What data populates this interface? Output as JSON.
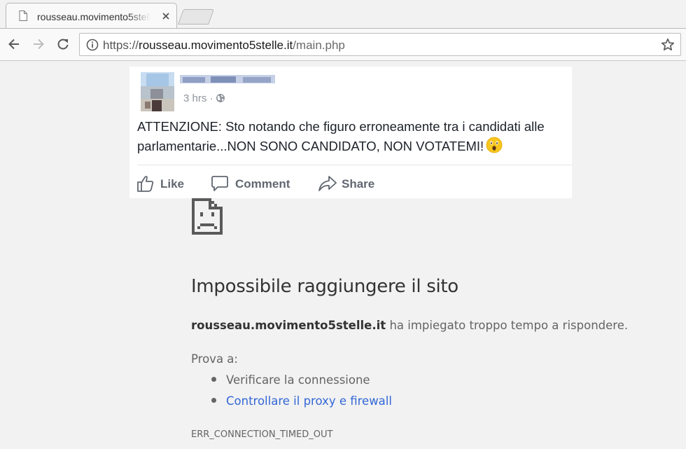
{
  "tab": {
    "title": "rousseau.movimento5stelle.it",
    "favicon": "page-icon",
    "close_icon": "close-icon"
  },
  "toolbar": {
    "back_icon": "back-arrow-icon",
    "forward_icon": "forward-arrow-icon",
    "reload_icon": "reload-icon",
    "info_icon": "info-icon",
    "bookmark_icon": "star-icon"
  },
  "address": {
    "scheme": "https://",
    "host": "rousseau.movimento5stelle.it",
    "path": "/main.php"
  },
  "post": {
    "time": "3 hrs ·",
    "audience_icon": "globe-icon",
    "line1": "ATTENZIONE: Sto notando che figuro erroneamente tra i candidati alle",
    "line2": "parlamentarie...NON SONO CANDIDATO, NON VOTATEMI!",
    "emoji": "astonished-face-emoji",
    "actions": {
      "like": "Like",
      "comment": "Comment",
      "share": "Share"
    }
  },
  "error": {
    "icon": "sad-page-icon",
    "title": "Impossibile raggiungere il sito",
    "host": "rousseau.movimento5stelle.it",
    "message": " ha impiegato troppo tempo a rispondere.",
    "try_label": "Prova a:",
    "suggestions": [
      {
        "text": "Verificare la connessione",
        "link": false
      },
      {
        "text": "Controllare il proxy e firewall",
        "link": true
      }
    ],
    "code": "ERR_CONNECTION_TIMED_OUT"
  },
  "colors": {
    "link": "#3367d6",
    "page_bg": "#f2f2f2",
    "fb_action": "#616770"
  }
}
